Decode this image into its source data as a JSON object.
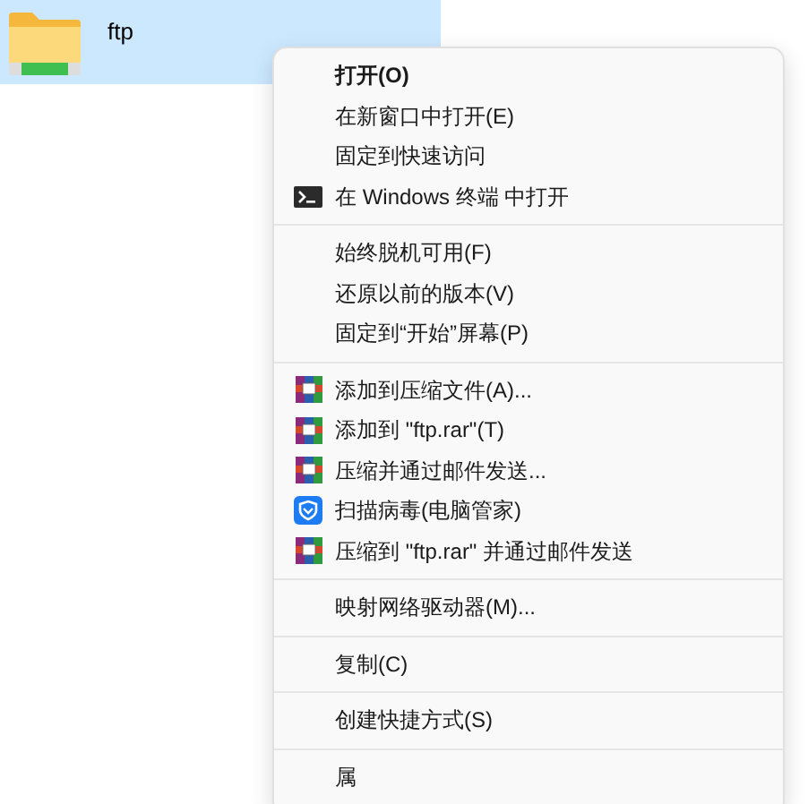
{
  "file": {
    "name": "ftp",
    "selected": true
  },
  "context_menu": {
    "groups": [
      {
        "items": [
          {
            "label": "打开(O)",
            "default": true
          },
          {
            "label": "在新窗口中打开(E)",
            "default": false
          },
          {
            "label": "固定到快速访问",
            "default": false
          },
          {
            "label": "在 Windows 终端 中打开",
            "default": false,
            "kind": "terminal"
          }
        ]
      },
      {
        "items": [
          {
            "label": "始终脱机可用(F)",
            "default": false
          },
          {
            "label": "还原以前的版本(V)",
            "default": false
          },
          {
            "label": "固定到“开始”屏幕(P)",
            "default": false
          }
        ]
      },
      {
        "items": [
          {
            "label": "添加到压缩文件(A)...",
            "default": false,
            "kind": "archive"
          },
          {
            "label": "添加到 \"ftp.rar\"(T)",
            "default": false,
            "kind": "archive"
          },
          {
            "label": "压缩并通过邮件发送...",
            "default": false,
            "kind": "archive"
          },
          {
            "label": "扫描病毒(电脑管家)",
            "default": false,
            "kind": "shield"
          },
          {
            "label": "压缩到 \"ftp.rar\" 并通过邮件发送",
            "default": false,
            "kind": "archive"
          }
        ]
      },
      {
        "items": [
          {
            "label": "映射网络驱动器(M)...",
            "default": false
          }
        ]
      },
      {
        "items": [
          {
            "label": "复制(C)",
            "default": false
          }
        ]
      },
      {
        "items": [
          {
            "label": "创建快捷方式(S)",
            "default": false
          }
        ]
      },
      {
        "items": [
          {
            "label": "属",
            "default": false
          }
        ]
      }
    ]
  }
}
